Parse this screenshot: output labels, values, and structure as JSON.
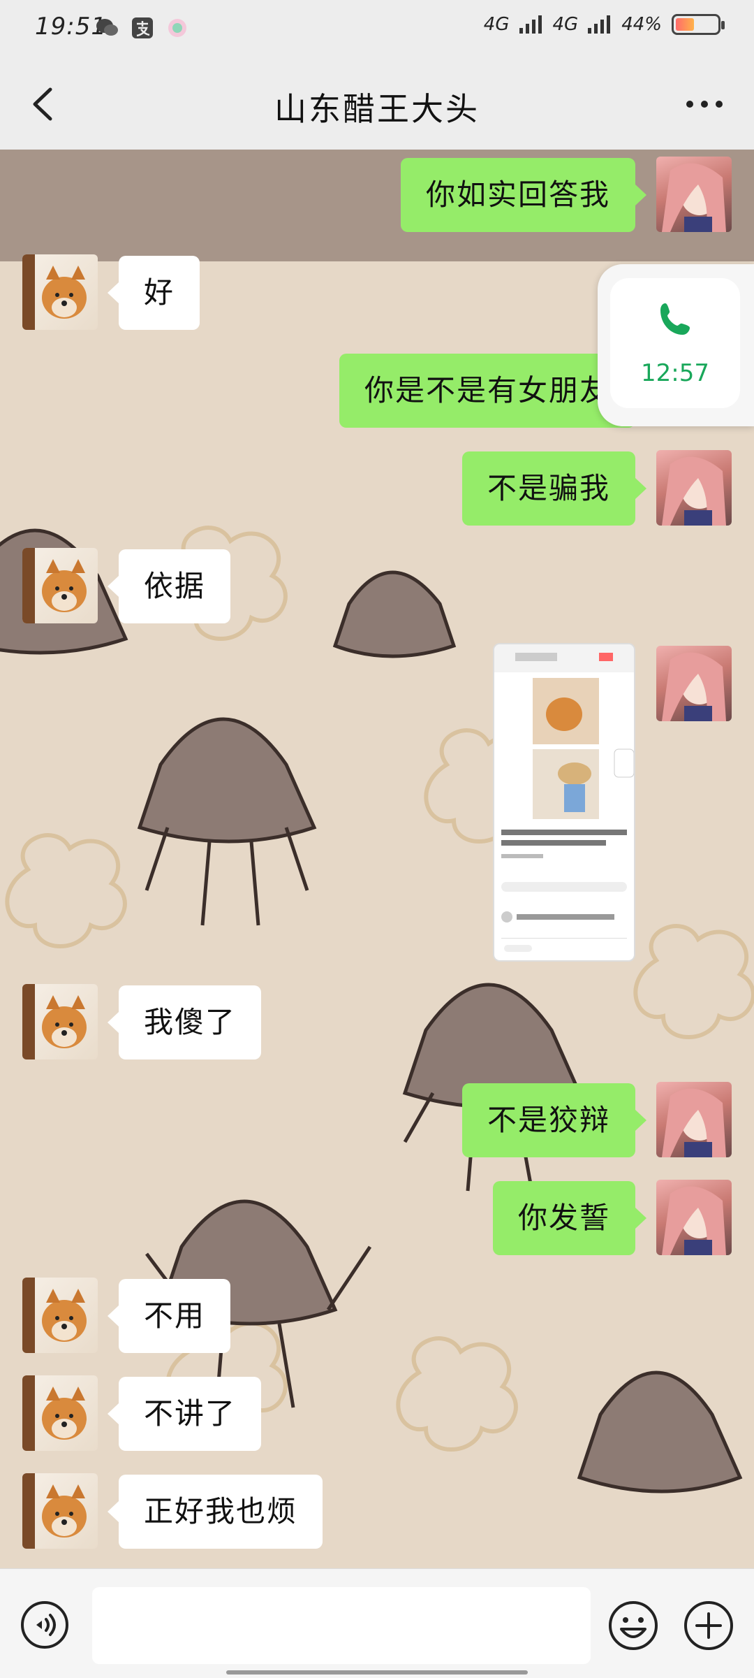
{
  "status_bar": {
    "time": "19:51",
    "network_1": "4G",
    "network_2": "4G",
    "battery": "44%"
  },
  "header": {
    "title": "山东醋王大头"
  },
  "messages": [
    {
      "side": "out",
      "text": "你如实回答我"
    },
    {
      "side": "in",
      "text": "好"
    },
    {
      "side": "out",
      "text": "你是不是有女朋友"
    },
    {
      "side": "out",
      "text": "不是骗我"
    },
    {
      "side": "in",
      "text": "依据"
    },
    {
      "side": "out",
      "type": "image"
    },
    {
      "side": "in",
      "text": "我傻了"
    },
    {
      "side": "out",
      "text": "不是狡辩"
    },
    {
      "side": "out",
      "text": "你发誓"
    },
    {
      "side": "in",
      "text": "不用"
    },
    {
      "side": "in",
      "text": "不讲了"
    },
    {
      "side": "in",
      "text": "正好我也烦"
    }
  ],
  "call_widget": {
    "time": "12:57"
  },
  "icons": [
    "back-icon",
    "more-icon",
    "phone-icon",
    "voice-icon",
    "emoji-icon",
    "plus-icon"
  ],
  "colors": {
    "outgoing_bubble": "#95ec69",
    "incoming_bubble": "#ffffff",
    "call_green": "#19a75a"
  }
}
